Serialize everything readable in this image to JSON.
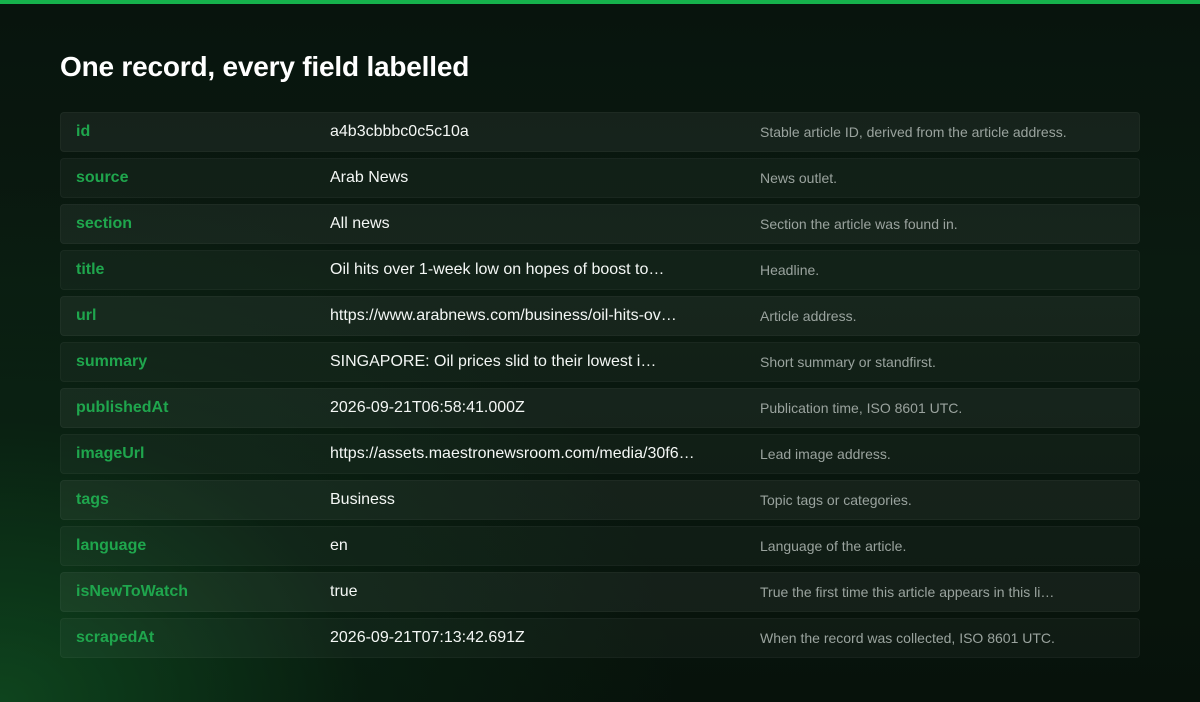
{
  "page": {
    "title": "One record, every field labelled",
    "accent_color": "#16b24c",
    "key_color": "#1fa64d"
  },
  "fields": [
    {
      "key": "id",
      "value": "a4b3cbbbc0c5c10a",
      "description": "Stable article ID, derived from the article address."
    },
    {
      "key": "source",
      "value": "Arab News",
      "description": "News outlet."
    },
    {
      "key": "section",
      "value": "All news",
      "description": "Section the article was found in."
    },
    {
      "key": "title",
      "value": "Oil hits over 1-week low on hopes of boost to…",
      "description": "Headline."
    },
    {
      "key": "url",
      "value": "https://www.arabnews.com/business/oil-hits-ov…",
      "description": "Article address."
    },
    {
      "key": "summary",
      "value": "SINGAPORE: Oil prices slid to their lowest i…",
      "description": "Short summary or standfirst."
    },
    {
      "key": "publishedAt",
      "value": "2026-09-21T06:58:41.000Z",
      "description": "Publication time, ISO 8601 UTC."
    },
    {
      "key": "imageUrl",
      "value": "https://assets.maestronewsroom.com/media/30f6…",
      "description": "Lead image address."
    },
    {
      "key": "tags",
      "value": "Business",
      "description": "Topic tags or categories."
    },
    {
      "key": "language",
      "value": "en",
      "description": "Language of the article."
    },
    {
      "key": "isNewToWatch",
      "value": "true",
      "description": "True the first time this article appears in this li…"
    },
    {
      "key": "scrapedAt",
      "value": "2026-09-21T07:13:42.691Z",
      "description": "When the record was collected, ISO 8601 UTC."
    }
  ]
}
